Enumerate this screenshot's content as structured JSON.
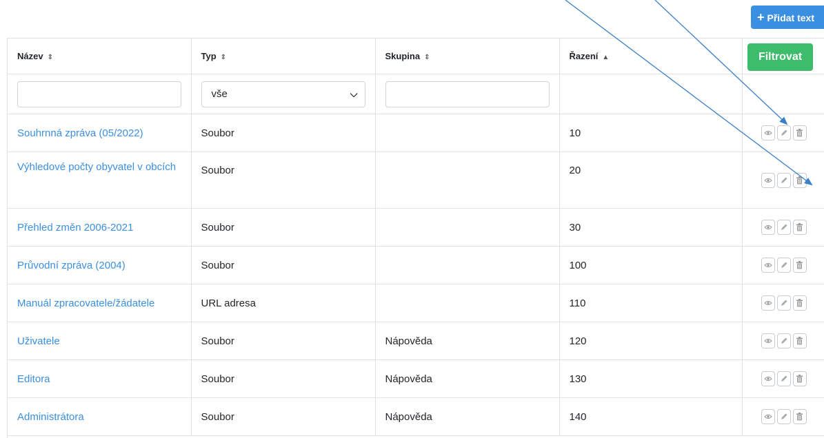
{
  "toolbar": {
    "add_label": "Přidat text",
    "add_icon": "plus-icon"
  },
  "filter": {
    "type_selected": "vše",
    "button_label": "Filtrovat"
  },
  "table": {
    "columns": [
      {
        "label": "Název",
        "sort": "both"
      },
      {
        "label": "Typ",
        "sort": "both"
      },
      {
        "label": "Skupina",
        "sort": "both"
      },
      {
        "label": "Řazení",
        "sort": "asc"
      }
    ],
    "rows": [
      {
        "name": "Souhrnná zpráva (05/2022)",
        "type": "Soubor",
        "group": "",
        "order": "10"
      },
      {
        "name": "Výhledové počty obyvatel v obcích",
        "type": "Soubor",
        "group": "",
        "order": "20"
      },
      {
        "name": "Přehled změn 2006-2021",
        "type": "Soubor",
        "group": "",
        "order": "30"
      },
      {
        "name": "Průvodní zpráva (2004)",
        "type": "Soubor",
        "group": "",
        "order": "100"
      },
      {
        "name": "Manuál zpracovatele/žádatele",
        "type": "URL adresa",
        "group": "",
        "order": "110"
      },
      {
        "name": "Uživatele",
        "type": "Soubor",
        "group": "Nápověda",
        "order": "120"
      },
      {
        "name": "Editora",
        "type": "Soubor",
        "group": "Nápověda",
        "order": "130"
      },
      {
        "name": "Administrátora",
        "type": "Soubor",
        "group": "Nápověda",
        "order": "140"
      }
    ],
    "row_actions": [
      "eye-icon",
      "pencil-icon",
      "trash-icon"
    ]
  },
  "colors": {
    "accent": "#3b8fe0",
    "success": "#3dbd6b",
    "annotation": "#3a7fc8"
  }
}
